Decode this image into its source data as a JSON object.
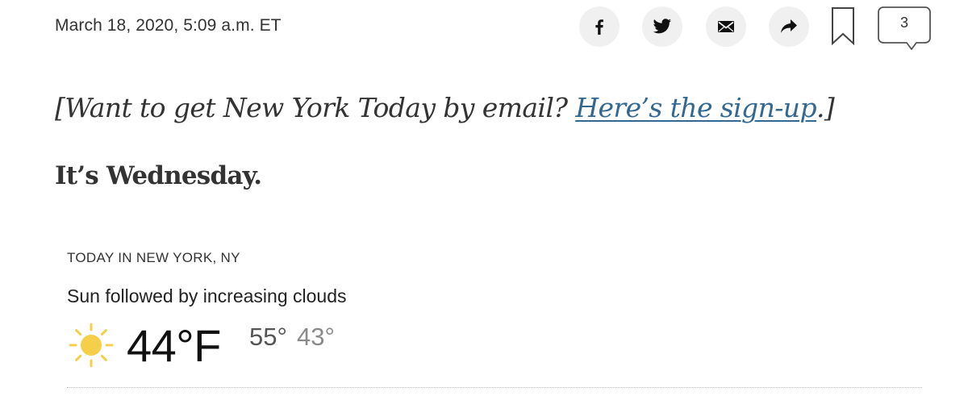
{
  "article": {
    "dateline": "March 18, 2020, 5:09 a.m. ET",
    "signup_prefix": "[Want to get New York Today by email? ",
    "signup_link": "Here’s the sign-up",
    "signup_suffix": ".]",
    "day_heading": "It’s Wednesday."
  },
  "share": {
    "buttons": [
      {
        "name": "facebook",
        "icon": "facebook-icon"
      },
      {
        "name": "twitter",
        "icon": "twitter-icon"
      },
      {
        "name": "email",
        "icon": "email-icon"
      },
      {
        "name": "share",
        "icon": "share-arrow-icon"
      }
    ],
    "bookmark_icon": "bookmark-icon",
    "comment_count": "3"
  },
  "weather": {
    "location": "TODAY IN NEW YORK, NY",
    "summary": "Sun followed by increasing clouds",
    "icon": "sun-icon",
    "current_temp": "44°F",
    "high": "55°",
    "low": "43°"
  },
  "colors": {
    "link": "#326891",
    "sun": "#f5cf4a",
    "button_bg": "#f0f0f0"
  }
}
